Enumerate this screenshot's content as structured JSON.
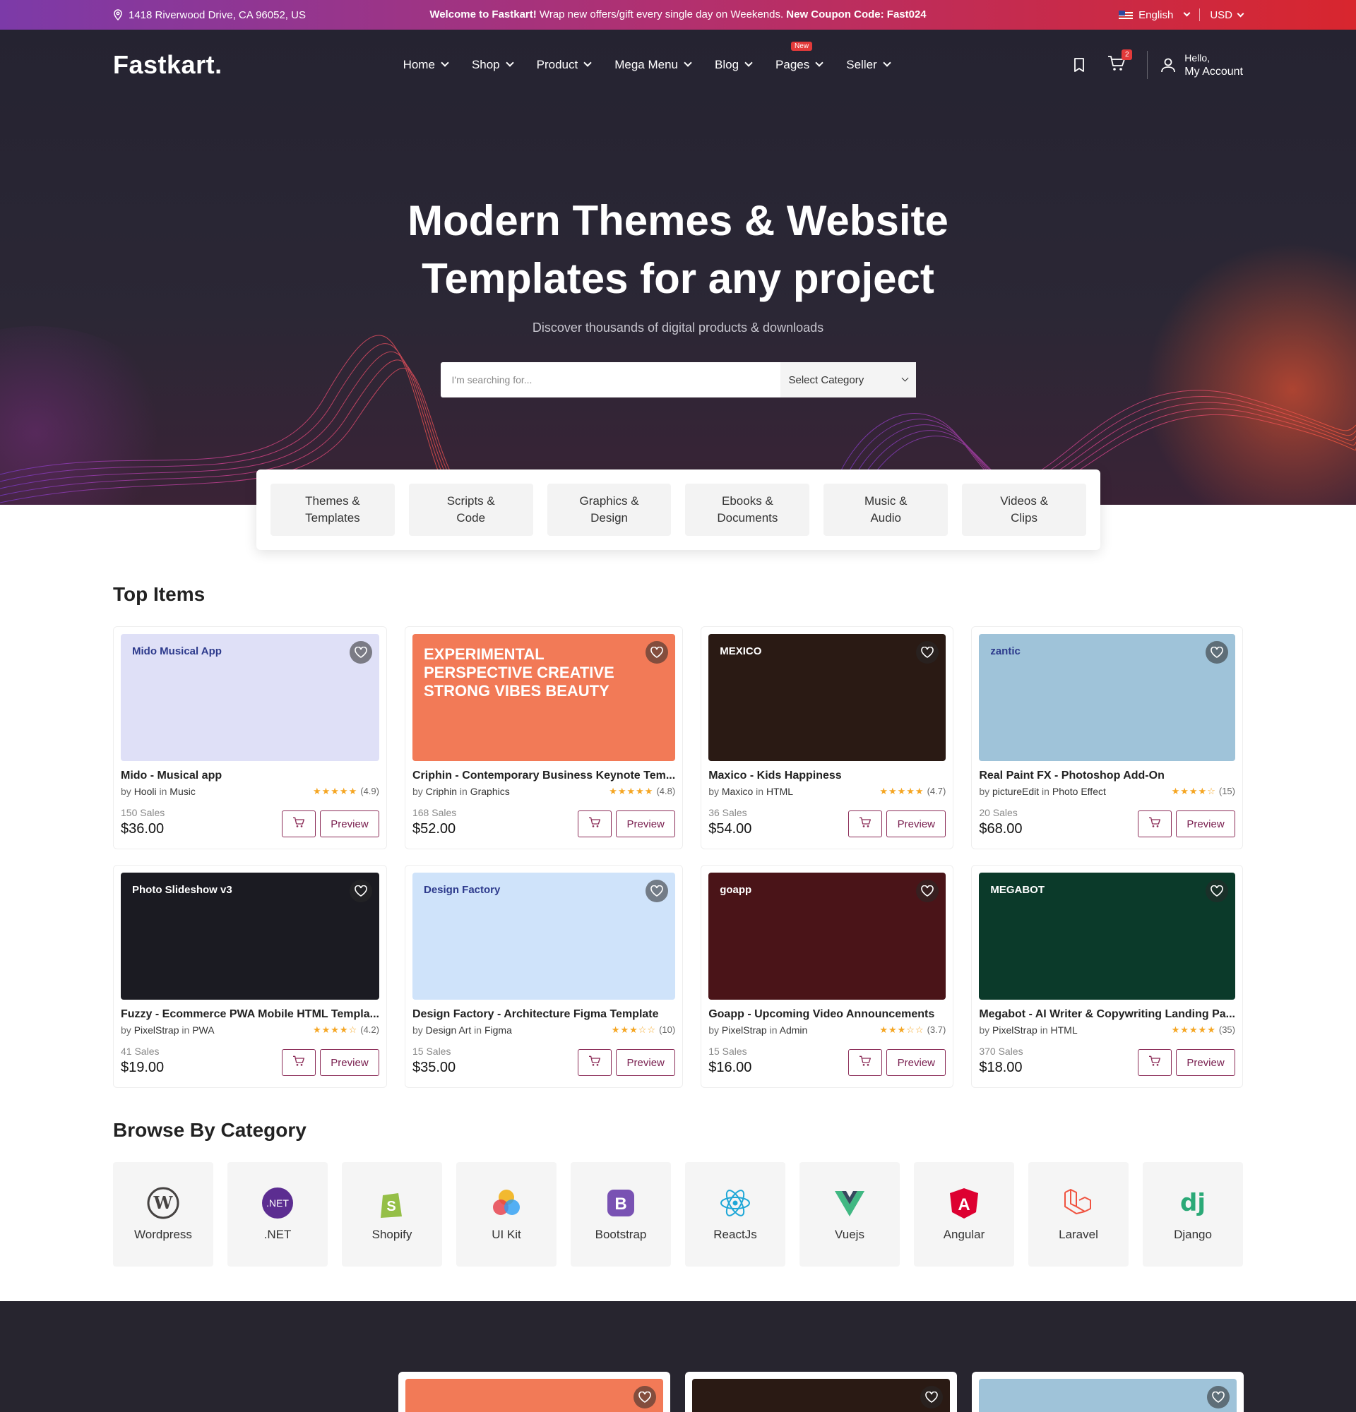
{
  "topbar": {
    "address": "1418 Riverwood Drive, CA 96052, US",
    "welcome_bold": "Welcome to Fastkart!",
    "welcome_text": " Wrap new offers/gift every single day on Weekends. ",
    "coupon": "New Coupon Code: Fast024",
    "language": "English",
    "currency": "USD"
  },
  "nav": {
    "logo": "Fastkart.",
    "menu": [
      {
        "label": "Home"
      },
      {
        "label": "Shop"
      },
      {
        "label": "Product"
      },
      {
        "label": "Mega Menu"
      },
      {
        "label": "Blog"
      },
      {
        "label": "Pages",
        "badge": "New"
      },
      {
        "label": "Seller"
      }
    ],
    "cart_count": "2",
    "hello": "Hello,",
    "account": "My Account"
  },
  "hero": {
    "title_line1": "Modern Themes & Website",
    "title_line2": "Templates for any project",
    "subtitle": "Discover thousands of digital products & downloads",
    "search_placeholder": "I'm searching for...",
    "category_select": "Select Category"
  },
  "categories": [
    "Themes &\nTemplates",
    "Scripts &\nCode",
    "Graphics &\nDesign",
    "Ebooks &\nDocuments",
    "Music &\nAudio",
    "Videos &\nClips"
  ],
  "top_items": {
    "title": "Top Items",
    "preview_label": "Preview",
    "items": [
      {
        "title": "Mido - Musical app",
        "author": "Hooli",
        "category": "Music",
        "stars": "★★★★★",
        "rating": "(4.9)",
        "sales": "150 Sales",
        "price": "$36.00",
        "thumb_text": "Mido Musical App",
        "color": "#dfe0f7"
      },
      {
        "title": "Criphin - Contemporary Business Keynote Tem...",
        "author": "Criphin",
        "category": "Graphics",
        "stars": "★★★★★",
        "rating": "(4.8)",
        "sales": "168 Sales",
        "price": "$52.00",
        "thumb_text": "EXPERIMENTAL PERSPECTIVE CREATIVE STRONG VIBES BEAUTY",
        "color": "#f27a57"
      },
      {
        "title": "Maxico - Kids Happiness",
        "author": "Maxico",
        "category": "HTML",
        "stars": "★★★★★",
        "rating": "(4.7)",
        "sales": "36 Sales",
        "price": "$54.00",
        "thumb_text": "MEXICO",
        "color": "#2a1a14"
      },
      {
        "title": "Real Paint FX - Photoshop Add-On",
        "author": "pictureEdit",
        "category": "Photo Effect",
        "stars": "★★★★☆",
        "rating": "(15)",
        "sales": "20 Sales",
        "price": "$68.00",
        "thumb_text": "zantic",
        "color": "#9fc3d9"
      },
      {
        "title": "Fuzzy - Ecommerce PWA Mobile HTML Templa...",
        "author": "PixelStrap",
        "category": "PWA",
        "stars": "★★★★☆",
        "rating": "(4.2)",
        "sales": "41 Sales",
        "price": "$19.00",
        "thumb_text": "Photo Slideshow v3",
        "color": "#1b1b22"
      },
      {
        "title": "Design Factory - Architecture Figma Template",
        "author": "Design Art",
        "category": "Figma",
        "stars": "★★★☆☆",
        "rating": "(10)",
        "sales": "15 Sales",
        "price": "$35.00",
        "thumb_text": "Design Factory",
        "color": "#cfe3fa"
      },
      {
        "title": "Goapp - Upcoming Video Announcements",
        "author": "PixelStrap",
        "category": "Admin",
        "stars": "★★★☆☆",
        "rating": "(3.7)",
        "sales": "15 Sales",
        "price": "$16.00",
        "thumb_text": "goapp",
        "color": "#4a1418"
      },
      {
        "title": "Megabot - AI Writer & Copywriting Landing Pa...",
        "author": "PixelStrap",
        "category": "HTML",
        "stars": "★★★★★",
        "rating": "(35)",
        "sales": "370 Sales",
        "price": "$18.00",
        "thumb_text": "MEGABOT",
        "color": "#0b3a2a"
      }
    ]
  },
  "browse": {
    "title": "Browse By Category",
    "items": [
      {
        "label": "Wordpress",
        "icon": "wordpress-icon",
        "color": "#464342"
      },
      {
        "label": ".NET",
        "icon": "dotnet-icon",
        "color": "#5c2d91"
      },
      {
        "label": "Shopify",
        "icon": "shopify-icon",
        "color": "#95bf47"
      },
      {
        "label": "UI Kit",
        "icon": "uikit-icon",
        "color": "#f2b21b"
      },
      {
        "label": "Bootstrap",
        "icon": "bootstrap-icon",
        "color": "#7952b3"
      },
      {
        "label": "ReactJs",
        "icon": "react-icon",
        "color": "#1ea7d7"
      },
      {
        "label": "Vuejs",
        "icon": "vue-icon",
        "color": "#41b883"
      },
      {
        "label": "Angular",
        "icon": "angular-icon",
        "color": "#dd0031"
      },
      {
        "label": "Laravel",
        "icon": "laravel-icon",
        "color": "#f05340"
      },
      {
        "label": "Django",
        "icon": "django-icon",
        "color": "#2ba977"
      }
    ]
  }
}
